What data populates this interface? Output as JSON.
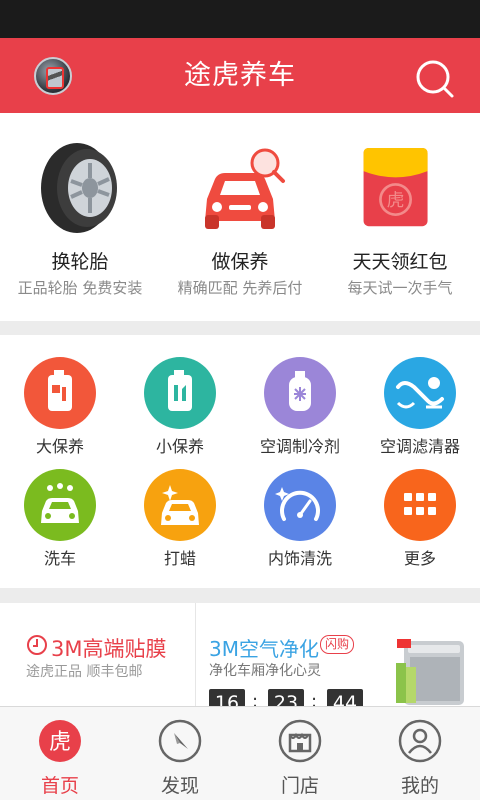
{
  "header": {
    "title": "途虎养车",
    "brand_logo": "car-brand-logo",
    "search_icon": "search-icon",
    "bg_color": "#e8404a"
  },
  "promo": [
    {
      "title": "换轮胎",
      "subtitle": "正品轮胎 免费安装",
      "icon": "tire-icon"
    },
    {
      "title": "做保养",
      "subtitle": "精确匹配 先养后付",
      "icon": "car-search-icon"
    },
    {
      "title": "天天领红包",
      "subtitle": "每天试一次手气",
      "icon": "red-packet-icon"
    }
  ],
  "services": [
    {
      "label": "大保养",
      "icon": "oil-bottle-icon",
      "color": "#f2573a"
    },
    {
      "label": "小保养",
      "icon": "oil-bottle-icon",
      "color": "#2db5a0"
    },
    {
      "label": "空调制冷剂",
      "icon": "refrigerant-icon",
      "color": "#9b86d8"
    },
    {
      "label": "空调滤清器",
      "icon": "ac-filter-icon",
      "color": "#2aa7e3"
    },
    {
      "label": "洗车",
      "icon": "car-wash-icon",
      "color": "#7bbb1f"
    },
    {
      "label": "打蜡",
      "icon": "car-wax-icon",
      "color": "#f7a20f"
    },
    {
      "label": "内饰清洗",
      "icon": "interior-clean-icon",
      "color": "#5a84e6"
    },
    {
      "label": "更多",
      "icon": "grid-icon",
      "color": "#f8651c"
    }
  ],
  "deals": {
    "left_title": "3M高端贴膜",
    "left_subtitle": "途虎正品 顺丰包邮",
    "right_title": "3M空气净化",
    "right_tag": "闪购",
    "right_subtitle": "净化车厢净化心灵",
    "countdown": [
      "16",
      "23",
      "44"
    ],
    "separator": ":"
  },
  "tabs": [
    {
      "label": "首页",
      "icon": "home-tiger-icon",
      "active": true,
      "icon_text": "虎"
    },
    {
      "label": "发现",
      "icon": "compass-icon",
      "active": false
    },
    {
      "label": "门店",
      "icon": "store-icon",
      "active": false
    },
    {
      "label": "我的",
      "icon": "user-icon",
      "active": false
    }
  ],
  "colors": {
    "accent": "#e8404a",
    "link": "#3aa3e3"
  }
}
